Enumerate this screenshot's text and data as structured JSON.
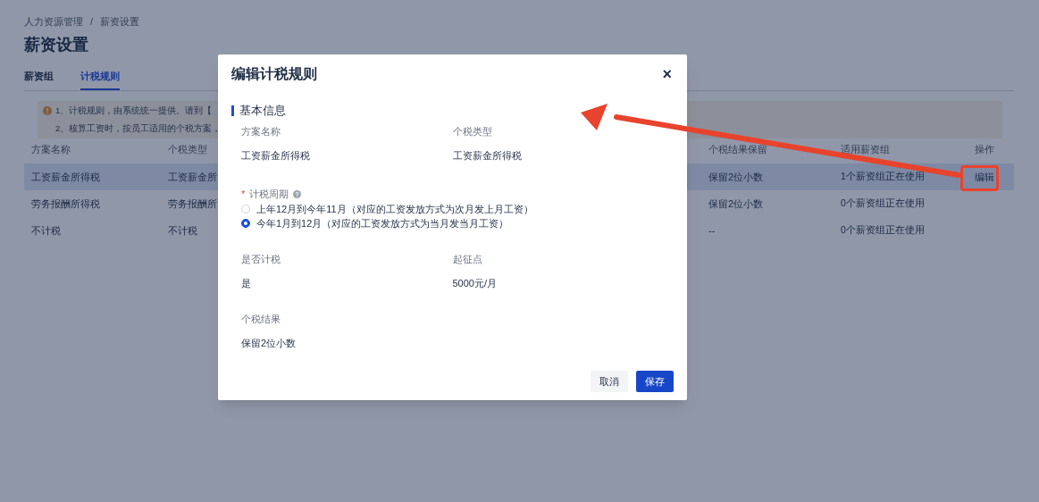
{
  "breadcrumb": {
    "items": [
      "人力资源管理",
      "薪资设置"
    ],
    "separator": "/"
  },
  "page_title": "薪资设置",
  "tabs": [
    {
      "label": "薪资组",
      "selected": false
    },
    {
      "label": "计税规则",
      "selected": true
    }
  ],
  "notice": {
    "lines": [
      "1、计税规则，由系统统一提供。请到【",
      "2、核算工资时，按员工适用的个税方案，"
    ]
  },
  "table": {
    "columns": [
      "方案名称",
      "个税类型",
      "个税结果保留",
      "适用薪资组",
      "操作"
    ],
    "rows": [
      {
        "name": "工资薪金所得税",
        "type": "工资薪金所",
        "decimals": "保留2位小数",
        "groups": "1个薪资组正在使用",
        "action": "编辑",
        "selected": true
      },
      {
        "name": "劳务报酬所得税",
        "type": "劳务报酬所",
        "decimals": "保留2位小数",
        "groups": "0个薪资组正在使用",
        "selected": false
      },
      {
        "name": "不计税",
        "type": "不计税",
        "decimals": "--",
        "groups": "0个薪资组正在使用",
        "selected": false
      }
    ]
  },
  "dialog": {
    "title": "编辑计税规则",
    "close": "×",
    "section": "基本信息",
    "fields_top": [
      {
        "label": "方案名称",
        "value": "工资薪金所得税"
      },
      {
        "label": "个税类型",
        "value": "工资薪金所得税"
      }
    ],
    "period": {
      "required_mark": "*",
      "label": "计税周期",
      "options": [
        {
          "label": "上年12月到今年11月（对应的工资发放方式为次月发上月工资）",
          "selected": false
        },
        {
          "label": "今年1月到12月（对应的工资发放方式为当月发当月工资）",
          "selected": true
        }
      ]
    },
    "fields_middle": [
      {
        "label": "是否计税",
        "value": "是"
      },
      {
        "label": "起征点",
        "value": "5000元/月"
      }
    ],
    "fields_bottom": [
      {
        "label": "个税结果",
        "value": "保留2位小数"
      }
    ],
    "buttons": [
      {
        "label": "取消",
        "kind": "secondary"
      },
      {
        "label": "保存",
        "kind": "primary"
      }
    ]
  }
}
